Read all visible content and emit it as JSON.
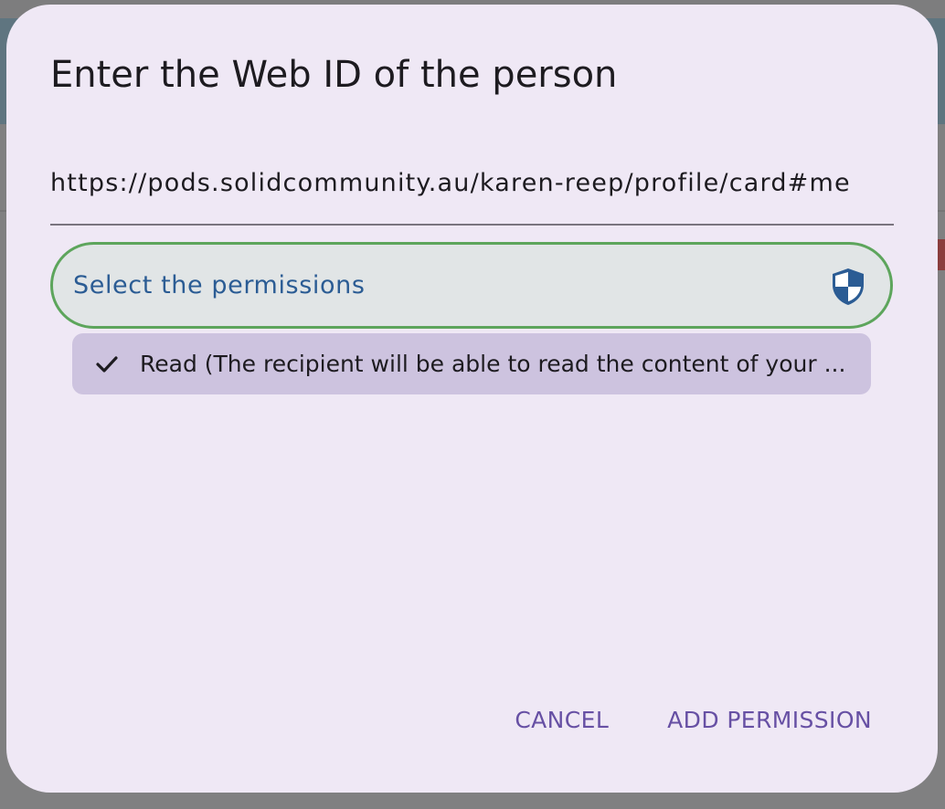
{
  "dialog": {
    "title": "Enter the Web ID of the person",
    "webid_value": "https://pods.solidcommunity.au/karen-reep/profile/card#me",
    "permission_select": {
      "label": "Select the permissions",
      "icon": "shield-icon"
    },
    "selected_options": [
      {
        "label": "Read (The recipient will be able to read the content of your ...",
        "icon": "check-icon"
      }
    ],
    "actions": {
      "cancel_label": "CANCEL",
      "add_label": "ADD PERMISSION"
    }
  },
  "colors": {
    "accent": "#6750a4",
    "field_border": "#5da55c",
    "label": "#2b5c94",
    "option_bg": "#cdc3df",
    "dialog_bg": "#efe8f5"
  }
}
